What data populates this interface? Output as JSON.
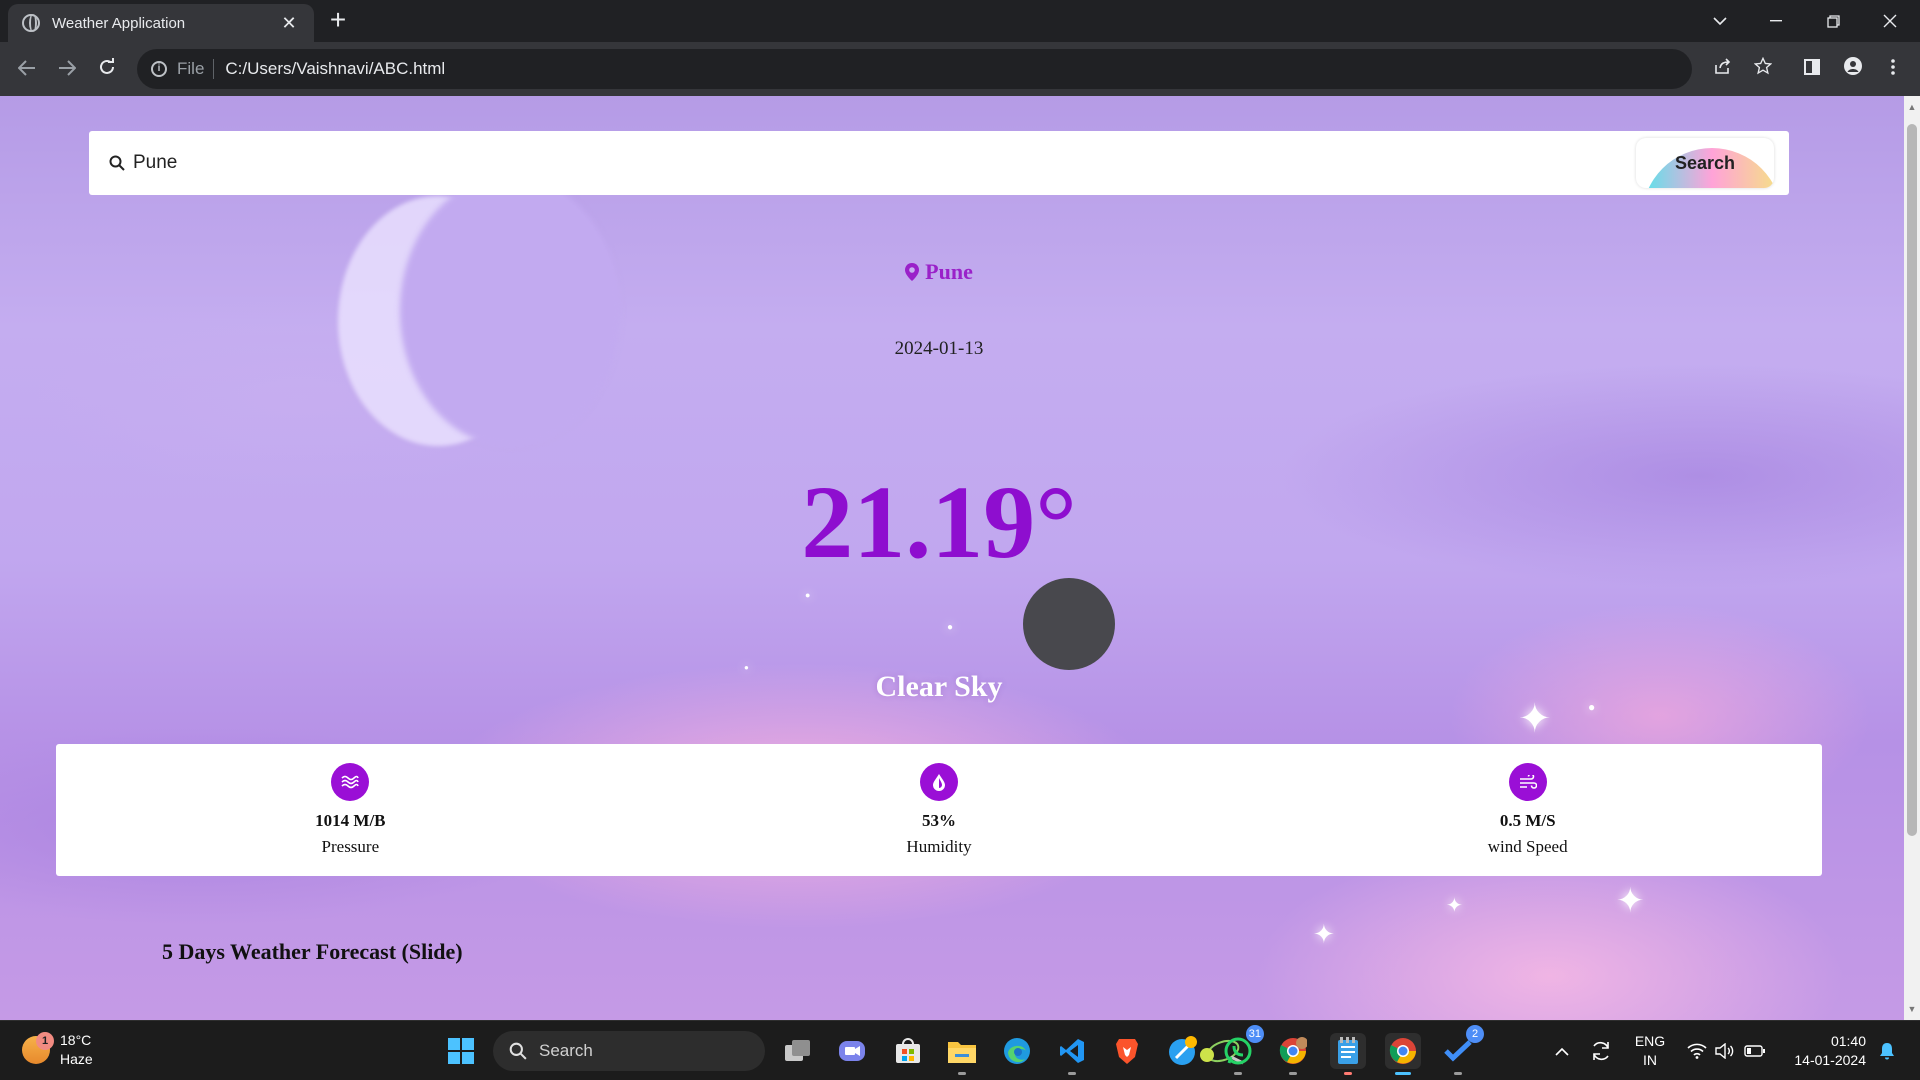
{
  "browser": {
    "tab_title": "Weather Application",
    "url_scheme_label": "File",
    "url": "C:/Users/Vaishnavi/ABC.html"
  },
  "app": {
    "search": {
      "value": "Pune",
      "button_label": "Search"
    },
    "city": "Pune",
    "date": "2024-01-13",
    "temperature": "21.19°",
    "weather_icon": "weather-condition-icon",
    "description": "Clear Sky",
    "stats": [
      {
        "value": "1014 M/B",
        "label": "Pressure",
        "icon": "pressure-waves-icon"
      },
      {
        "value": "53%",
        "label": "Humidity",
        "icon": "humidity-drop-icon"
      },
      {
        "value": "0.5 M/S",
        "label": "wind Speed",
        "icon": "wind-icon"
      }
    ],
    "forecast_heading": "5 Days Weather Forecast (Slide)",
    "colors": {
      "accent": "#9a0fd6",
      "temperature": "#8e0ecf",
      "city": "#9a21c9"
    }
  },
  "taskbar": {
    "weather": {
      "temp": "18°C",
      "condition": "Haze",
      "badge": "1"
    },
    "search_label": "Search",
    "whatsapp_badge": "31",
    "todo_badge": "2",
    "lang_top": "ENG",
    "lang_bottom": "IN",
    "time": "01:40",
    "date": "14-01-2024"
  }
}
